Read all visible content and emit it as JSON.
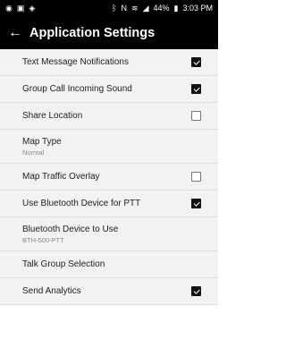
{
  "status_bar": {
    "battery": "44%",
    "time": "3:03 PM",
    "icons": [
      "notification-icon",
      "gallery-icon",
      "location-icon",
      "bluetooth-icon",
      "nfc-icon",
      "wifi-icon",
      "signal-icon",
      "battery-icon"
    ]
  },
  "header": {
    "title": "Application Settings",
    "back_icon": "back-arrow-icon"
  },
  "settings": [
    {
      "label": "Text Message Notifications",
      "checkbox": true
    },
    {
      "label": "Group Call Incoming Sound",
      "checkbox": true
    },
    {
      "label": "Share Location",
      "checkbox": false
    },
    {
      "label": "Map Type",
      "sub": "Normal"
    },
    {
      "label": "Map Traffic Overlay",
      "checkbox": false
    },
    {
      "label": "Use Bluetooth Device for PTT",
      "checkbox": true
    },
    {
      "label": "Bluetooth Device to Use",
      "sub": "BTH-500-PTT"
    },
    {
      "label": "Talk Group Selection"
    },
    {
      "label": "Send Analytics",
      "checkbox": true
    }
  ],
  "colors": {
    "bar": "#000000",
    "list_bg": "#f2f2f2",
    "divider": "#dedede"
  }
}
